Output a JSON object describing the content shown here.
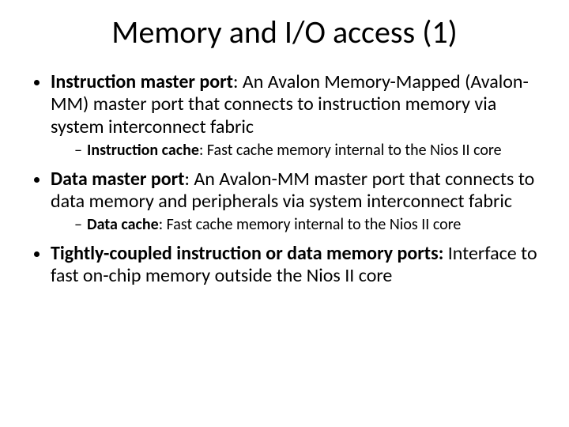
{
  "title": "Memory and I/O access (1)",
  "bullets": [
    {
      "term": "Instruction master port",
      "desc": ": An Avalon Memory-Mapped (Avalon-MM) master port that connects to instruction memory via system interconnect fabric",
      "children": [
        {
          "term": "Instruction cache",
          "desc": ": Fast cache memory internal to the Nios II core"
        }
      ]
    },
    {
      "term": "Data master port",
      "desc": ": An Avalon-MM master port that connects to data memory and peripherals via system interconnect  fabric",
      "children": [
        {
          "term": "Data cache",
          "desc": ": Fast cache memory internal to the Nios II core"
        }
      ]
    },
    {
      "term": "Tightly-coupled instruction or data memory ports: ",
      "desc": "Interface to fast on-chip memory outside the Nios II core",
      "children": []
    }
  ]
}
